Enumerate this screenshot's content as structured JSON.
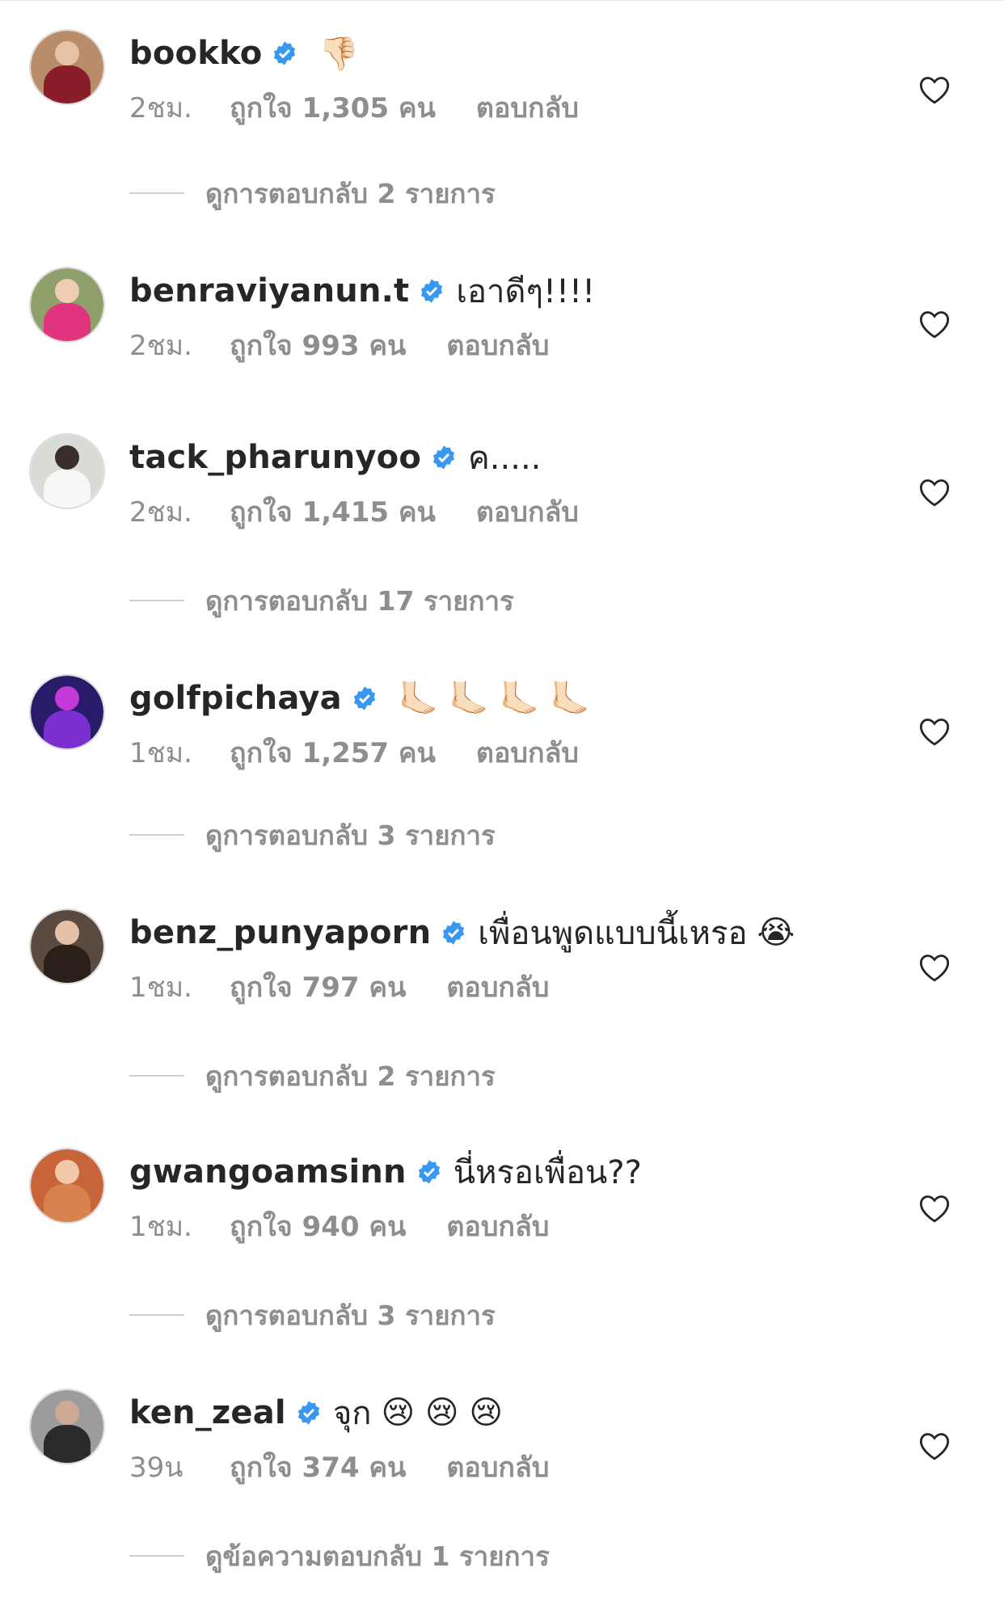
{
  "comments": [
    {
      "username": "bookko",
      "text": "",
      "emoji": "👎🏻",
      "timestamp": "2ชม.",
      "likes": "ถูกใจ 1,305 คน",
      "reply_label": "ตอบกลับ",
      "view_replies": "ดูการตอบกลับ 2 รายการ"
    },
    {
      "username": "benraviyanun.t",
      "text": "เอาดีๆ!!!!",
      "emoji": "",
      "timestamp": "2ชม.",
      "likes": "ถูกใจ 993 คน",
      "reply_label": "ตอบกลับ",
      "view_replies": ""
    },
    {
      "username": "tack_pharunyoo",
      "text": "ค.....",
      "emoji": "",
      "timestamp": "2ชม.",
      "likes": "ถูกใจ 1,415 คน",
      "reply_label": "ตอบกลับ",
      "view_replies": "ดูการตอบกลับ 17 รายการ"
    },
    {
      "username": "golfpichaya",
      "text": "",
      "emoji": "🦶🏻 🦶🏻 🦶🏻 🦶🏻",
      "timestamp": "1ชม.",
      "likes": "ถูกใจ 1,257 คน",
      "reply_label": "ตอบกลับ",
      "view_replies": "ดูการตอบกลับ 3 รายการ"
    },
    {
      "username": "benz_punyaporn",
      "text": "เพื่อนพูดแบบนี้เหรอ",
      "emoji": "😭",
      "timestamp": "1ชม.",
      "likes": "ถูกใจ 797 คน",
      "reply_label": "ตอบกลับ",
      "view_replies": "ดูการตอบกลับ 2 รายการ"
    },
    {
      "username": "gwangoamsinn",
      "text": "นี่หรอเพื่อน??",
      "emoji": "",
      "timestamp": "1ชม.",
      "likes": "ถูกใจ 940 คน",
      "reply_label": "ตอบกลับ",
      "view_replies": "ดูการตอบกลับ 3 รายการ"
    },
    {
      "username": "ken_zeal",
      "text": "จุก",
      "emoji": "😢 😢 😢",
      "timestamp": "39น",
      "likes": "ถูกใจ 374 คน",
      "reply_label": "ตอบกลับ",
      "view_replies": "ดูข้อความตอบกลับ 1 รายการ"
    }
  ],
  "icons": {
    "verified": "verified-badge-icon",
    "like": "heart-outline-icon"
  },
  "colors": {
    "verified_blue": "#3897f0",
    "secondary_text": "#8e8e8e",
    "primary_text": "#262626"
  }
}
